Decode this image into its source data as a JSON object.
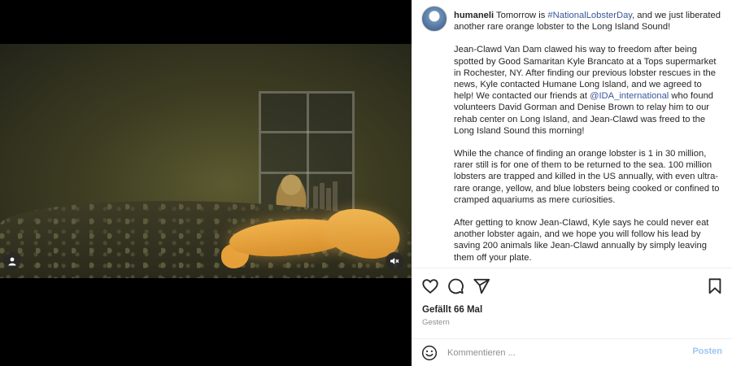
{
  "post": {
    "username": "humaneli",
    "caption_intro": " Tomorrow is ",
    "hashtag": "#NationalLobsterDay",
    "caption_intro_end": ", and we just liberated another rare orange lobster to the Long Island Sound!",
    "para2_a": "Jean-Clawd Van Dam clawed his way to freedom after being spotted by Good Samaritan Kyle Brancato at a Tops supermarket in Rochester, NY. After finding our previous lobster rescues in the news, Kyle contacted Humane Long Island, and we agreed to help! We contacted our friends at ",
    "mention": "@IDA_international",
    "para2_b": " who found volunteers David Gorman and Denise Brown to relay him to our rehab center on Long Island, and Jean-Clawd was freed to the Long Island Sound this morning!",
    "para3": "While the chance of finding an orange lobster is 1 in 30 million, rarer still is for one of them to be returned to the sea. 100 million lobsters are trapped and killed in the US annually, with even ultra-rare orange, yellow, and blue lobsters being cooked or confined to cramped aquariums as mere curiosities.",
    "para4": "After getting to know Jean-Clawd, Kyle says he could never eat another lobster again, and we hope you will follow his lead by saving 200 animals like Jean-Clawd annually by simply leaving them off your plate.",
    "likes": "Gefällt 66 Mal",
    "date": "Gestern"
  },
  "comment": {
    "placeholder": "Kommentieren ...",
    "post_label": "Posten"
  },
  "icons": {
    "like": "heart-icon",
    "comment": "comment-bubble-icon",
    "share": "paper-plane-icon",
    "save": "bookmark-icon",
    "emoji": "smiley-icon",
    "user_tag": "user-icon",
    "mute": "speaker-muted-icon"
  },
  "colors": {
    "link": "#385898",
    "post_button": "#9cc6f2",
    "meta_text": "#8e8e8e"
  }
}
